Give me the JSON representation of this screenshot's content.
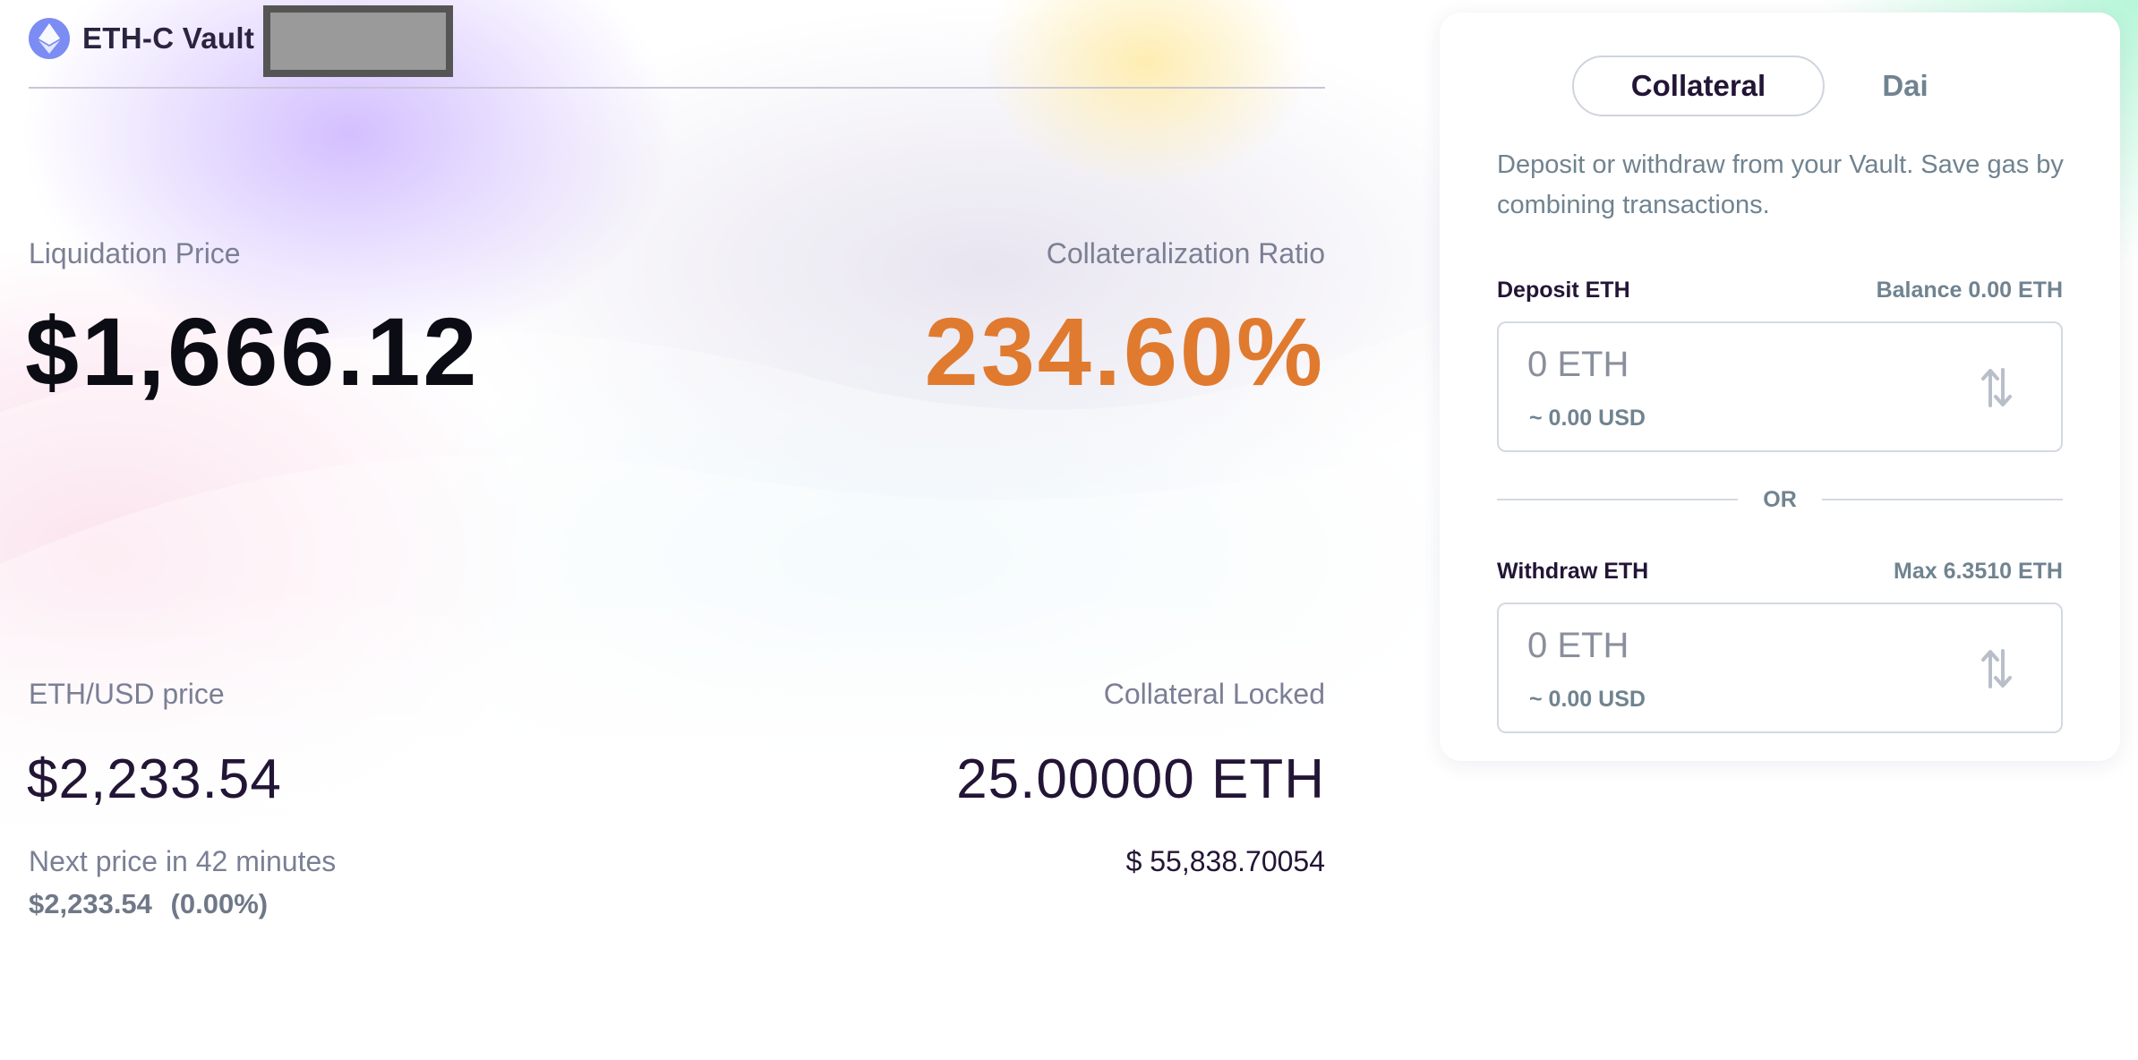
{
  "header": {
    "vault_title": "ETH-C Vault",
    "logo_icon": "ethereum-icon"
  },
  "stats": {
    "liquidation_price": {
      "label": "Liquidation Price",
      "value": "$1,666.12"
    },
    "collateralization_ratio": {
      "label": "Collateralization Ratio",
      "value": "234.60%"
    },
    "eth_usd_price": {
      "label": "ETH/USD price",
      "value": "$2,233.54",
      "next_price_text": "Next price in 42 minutes",
      "next_price_value": "$2,233.54",
      "next_price_change": "(0.00%)"
    },
    "collateral_locked": {
      "label": "Collateral Locked",
      "value": "25.00000 ETH",
      "usd_value": "$ 55,838.70054"
    }
  },
  "panel": {
    "tabs": [
      {
        "label": "Collateral",
        "active": true
      },
      {
        "label": "Dai",
        "active": false
      }
    ],
    "description": "Deposit or withdraw from your Vault. Save gas by combining transactions.",
    "deposit": {
      "label": "Deposit ETH",
      "balance_text": "Balance 0.00 ETH",
      "placeholder": "0 ETH",
      "usd_text": "~ 0.00 USD"
    },
    "or_text": "OR",
    "withdraw": {
      "label": "Withdraw ETH",
      "max_text": "Max 6.3510 ETH",
      "placeholder": "0 ETH",
      "usd_text": "~ 0.00 USD"
    }
  },
  "colors": {
    "ratio_orange": "#e07a2f",
    "eth_logo": "#7b8cf3",
    "text_dark": "#231536",
    "text_muted": "#708390"
  }
}
